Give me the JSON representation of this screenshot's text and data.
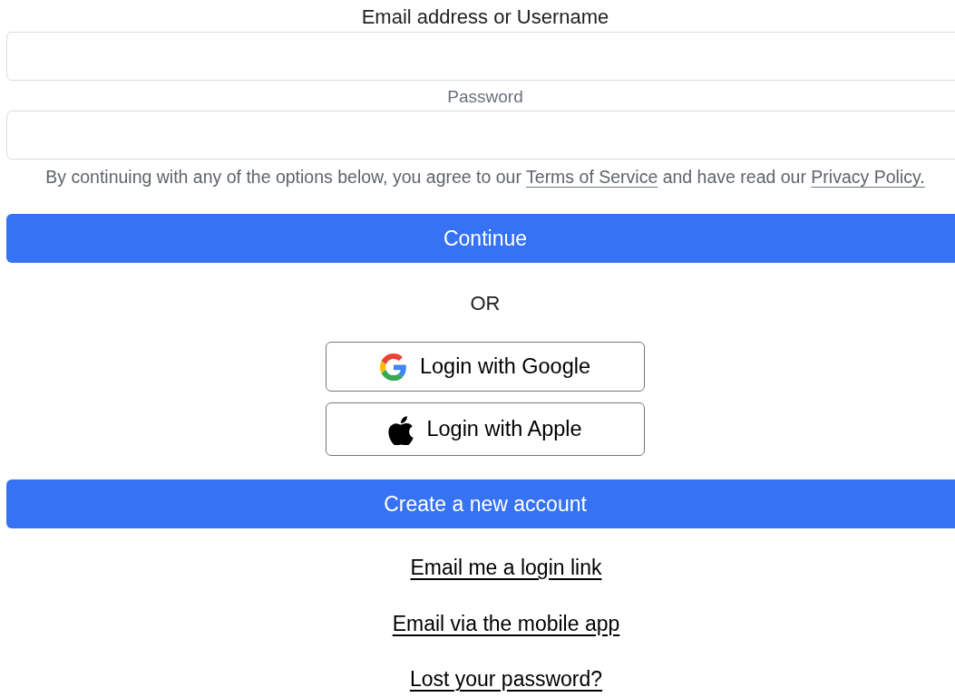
{
  "fields": [
    {
      "label": "Email address or Username"
    },
    {
      "label": "Password"
    }
  ],
  "terms": {
    "before": "By continuing with any of the options below, you agree to our",
    "terms_link": "Terms of Service",
    "middle": "and have read our",
    "privacy_link": "Privacy Policy."
  },
  "continue_button": "Continue",
  "divider": "OR",
  "social_buttons": [
    {
      "label": "Login with Google",
      "kind": "google"
    },
    {
      "label": "Login with Apple",
      "kind": "apple"
    }
  ],
  "create_account_button": "Create a new account",
  "links": [
    "Email me a login link",
    "Email via the mobile app",
    "Lost your password?"
  ]
}
